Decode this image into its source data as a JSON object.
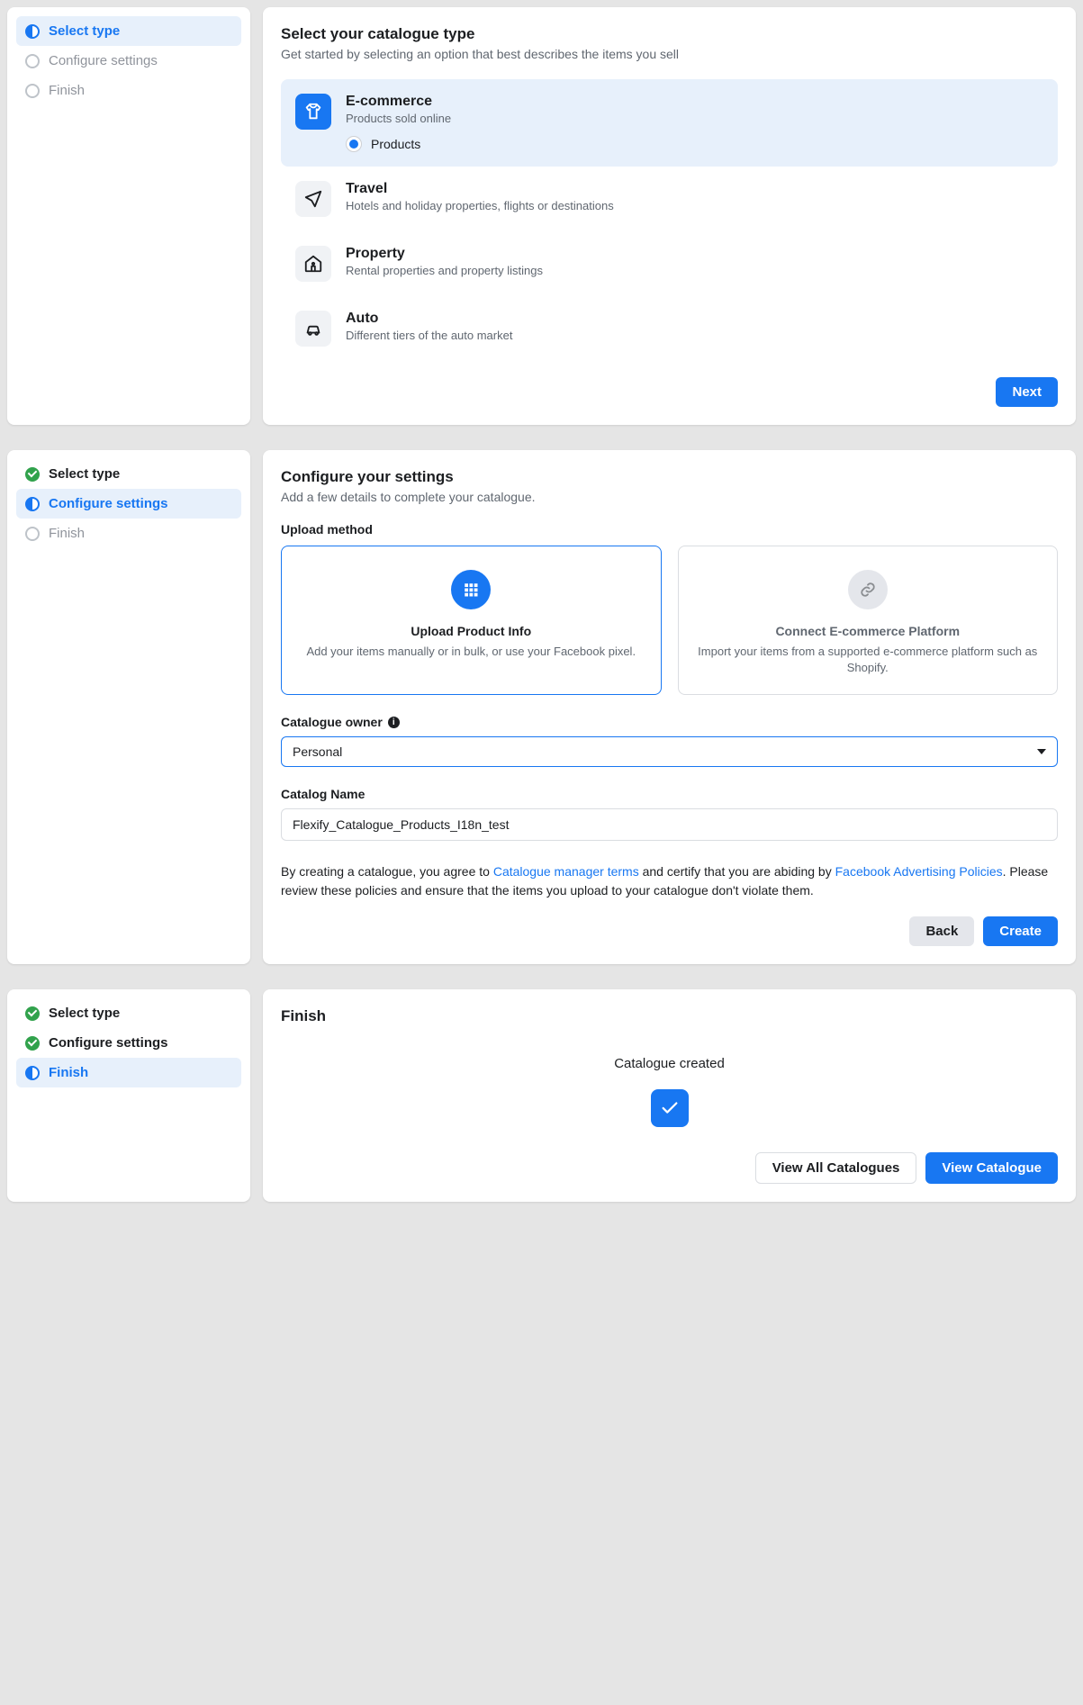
{
  "steps": {
    "s1": "Select type",
    "s2": "Configure settings",
    "s3": "Finish"
  },
  "panel1": {
    "title": "Select your catalogue type",
    "subtitle": "Get started by selecting an option that best describes the items you sell",
    "options": [
      {
        "title": "E-commerce",
        "desc": "Products sold online",
        "radio_label": "Products"
      },
      {
        "title": "Travel",
        "desc": "Hotels and holiday properties, flights or destinations"
      },
      {
        "title": "Property",
        "desc": "Rental properties and property listings"
      },
      {
        "title": "Auto",
        "desc": "Different tiers of the auto market"
      }
    ],
    "next_btn": "Next"
  },
  "panel2": {
    "title": "Configure your settings",
    "subtitle": "Add a few details to complete your catalogue.",
    "upload_label": "Upload method",
    "upload_cards": [
      {
        "title": "Upload Product Info",
        "desc": "Add your items manually or in bulk, or use your Facebook pixel."
      },
      {
        "title": "Connect E-commerce Platform",
        "desc": "Import your items from a supported e-commerce platform such as Shopify."
      }
    ],
    "owner_label": "Catalogue owner",
    "owner_value": "Personal",
    "name_label": "Catalog Name",
    "name_value": "Flexify_Catalogue_Products_I18n_test",
    "agree_1": "By creating a catalogue, you agree to ",
    "agree_link1": "Catalogue manager terms",
    "agree_2": " and certify that you are abiding by ",
    "agree_link2": "Facebook Advertising Policies",
    "agree_3": ". Please review these policies and ensure that the items you upload to your catalogue don't violate them.",
    "back_btn": "Back",
    "create_btn": "Create"
  },
  "panel3": {
    "title": "Finish",
    "created": "Catalogue created",
    "view_all": "View All Catalogues",
    "view_one": "View Catalogue"
  }
}
